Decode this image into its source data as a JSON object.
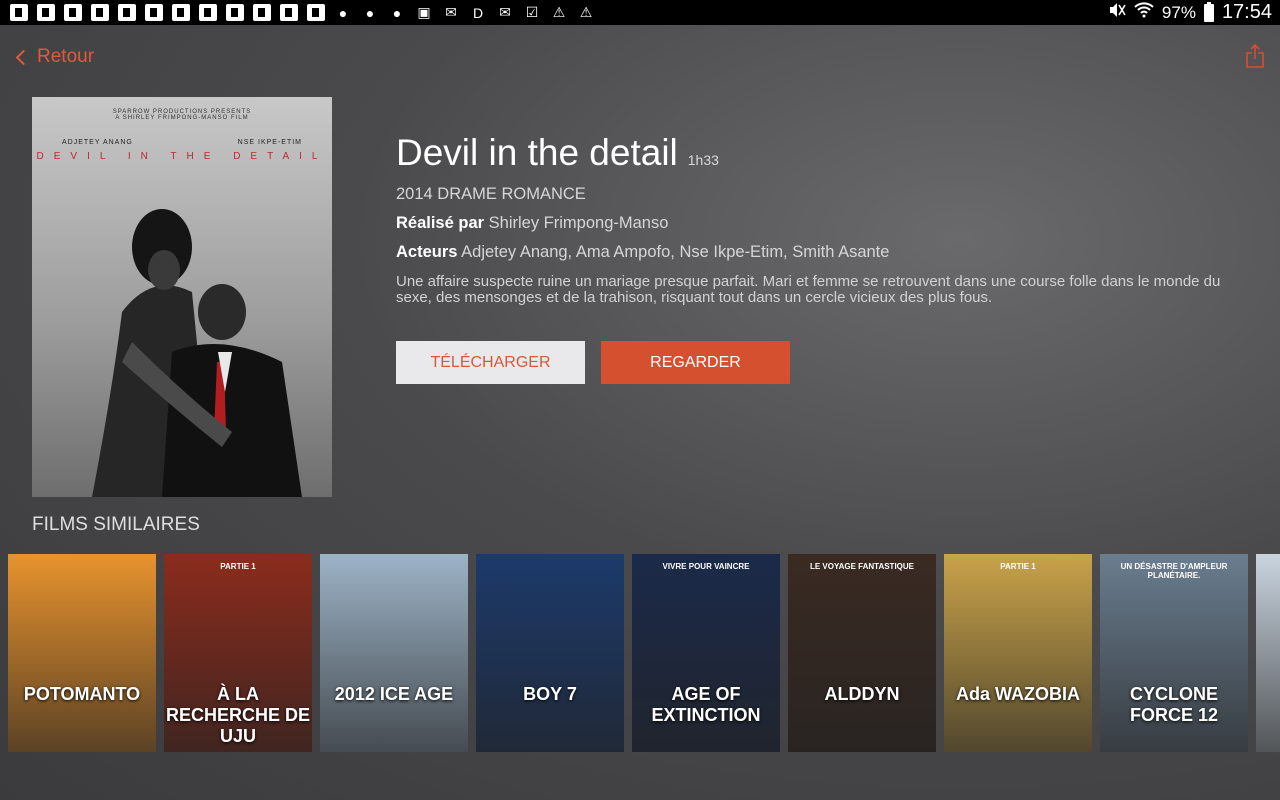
{
  "status_bar": {
    "battery": "97%",
    "time": "17:54",
    "icons": [
      "notification-icon",
      "notification-icon",
      "notification-icon",
      "notification-icon",
      "notification-icon",
      "notification-icon",
      "notification-icon",
      "notification-icon",
      "notification-icon",
      "notification-icon",
      "notification-icon",
      "notification-icon",
      "keyhole-icon",
      "keyhole-icon",
      "keyhole-icon",
      "image-icon",
      "mail-icon",
      "d-icon",
      "mail-icon",
      "clipboard-check-icon",
      "warning-icon",
      "warning-icon"
    ]
  },
  "nav": {
    "back_label": "Retour"
  },
  "poster": {
    "production": "SPARROW PRODUCTIONS PRESENTS\nA SHIRLEY FRIMPONG-MANSO FILM",
    "actor_left": "ADJETEY ANANG",
    "actor_right": "NSE IKPE-ETIM",
    "title": "DEVIL IN THE DETAIL"
  },
  "movie": {
    "title": "Devil in the detail",
    "duration": "1h33",
    "year_genres": "2014 DRAME ROMANCE",
    "director_label": "Réalisé par",
    "director": "Shirley Frimpong-Manso",
    "actors_label": "Acteurs",
    "actors": "Adjetey Anang, Ama Ampofo, Nse Ikpe-Etim, Smith Asante",
    "description": "Une affaire suspecte ruine un mariage presque parfait. Mari et femme se retrouvent dans une course folle dans le monde du sexe, des mensonges et de la trahison, risquant tout dans un  cercle vicieux des plus fous."
  },
  "buttons": {
    "download": "TÉLÉCHARGER",
    "watch": "REGARDER"
  },
  "similar": {
    "title": "FILMS SIMILAIRES",
    "items": [
      {
        "label": "POTOMANTO",
        "color": "#e8932e"
      },
      {
        "label": "À LA RECHERCHE DE UJU",
        "sub": "PARTIE 1",
        "color": "#8b2c1c"
      },
      {
        "label": "2012 ICE AGE",
        "color": "#9db3c7"
      },
      {
        "label": "BOY 7",
        "color": "#1c3a6b"
      },
      {
        "label": "AGE OF EXTINCTION",
        "sub": "VIVRE POUR VAINCRE",
        "color": "#1b2a4a"
      },
      {
        "label": "ALDDYN",
        "sub": "LE VOYAGE FANTASTIQUE",
        "color": "#3a2a22"
      },
      {
        "label": "Ada WAZOBIA",
        "sub": "PARTIE 1",
        "color": "#c9a34a"
      },
      {
        "label": "CYCLONE FORCE 12",
        "sub": "UN DÉSASTRE D'AMPLEUR PLANÉTAIRE.",
        "color": "#6a7d8f"
      },
      {
        "label": "",
        "color": "#c9d4df"
      }
    ]
  }
}
